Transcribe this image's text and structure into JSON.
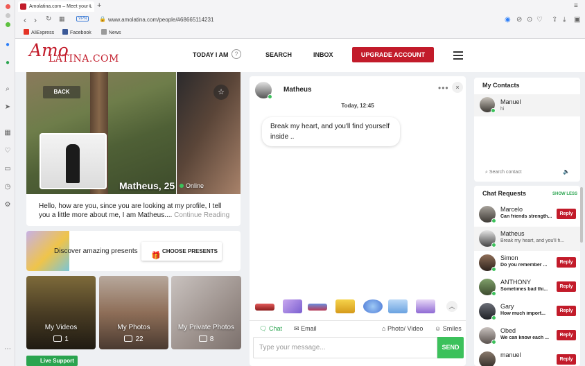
{
  "browser": {
    "tab_title": "Amolatina.com – Meet your L",
    "url": "www.amolatina.com/people/#68665114231",
    "vpn_label": "VPN",
    "bookmarks": [
      "AliExpress",
      "Facebook",
      "News"
    ]
  },
  "header": {
    "logo_amo": "Amo",
    "logo_latina": "LATINA.COM",
    "nav": [
      "TODAY I AM",
      "SEARCH",
      "INBOX"
    ],
    "upgrade_label": "UPGRADE ACCOUNT"
  },
  "profile": {
    "back_label": "BACK",
    "name_age": "Matheus, 25",
    "status": "Online",
    "bio": "Hello, how are you, since you are looking at my profile, I tell you a little more about me, I am Matheus....",
    "continue_label": "Continue Reading"
  },
  "presents": {
    "text": "Discover amazing presents",
    "button_label": "CHOOSE PRESENTS"
  },
  "media": [
    {
      "label": "My Videos",
      "count": "1"
    },
    {
      "label": "My Photos",
      "count": "22"
    },
    {
      "label": "My Private Photos",
      "count": "8"
    }
  ],
  "live_support": "Live Support",
  "chat": {
    "name": "Matheus",
    "date": "Today, 12:45",
    "message": "Break my heart, and you'll find yourself inside ..",
    "tabs": [
      "Chat",
      "Email",
      "Photo/ Video",
      "Smiles"
    ],
    "input_placeholder": "Type your message...",
    "send_label": "SEND"
  },
  "contacts": {
    "title": "My Contacts",
    "items": [
      {
        "name": "Manuel",
        "message": "hi"
      }
    ],
    "search_placeholder": "Search contact"
  },
  "requests": {
    "title": "Chat Requests",
    "show_less": "SHOW LESS",
    "reply_label": "Reply",
    "items": [
      {
        "name": "Marcelo",
        "message": "Can friends strength..."
      },
      {
        "name": "Matheus",
        "message": "Break my heart, and you'll fi..."
      },
      {
        "name": "Simon",
        "message": "Do you remember ..."
      },
      {
        "name": "ANTHONY",
        "message": "Sometimes bad thi..."
      },
      {
        "name": "Gary",
        "message": "How much import..."
      },
      {
        "name": "Obed",
        "message": "We can know each ..."
      },
      {
        "name": "manuel",
        "message": ""
      }
    ]
  },
  "colors": {
    "brand": "#c21b2a",
    "online": "#3cc15b",
    "accent_green": "#2aa44f"
  }
}
